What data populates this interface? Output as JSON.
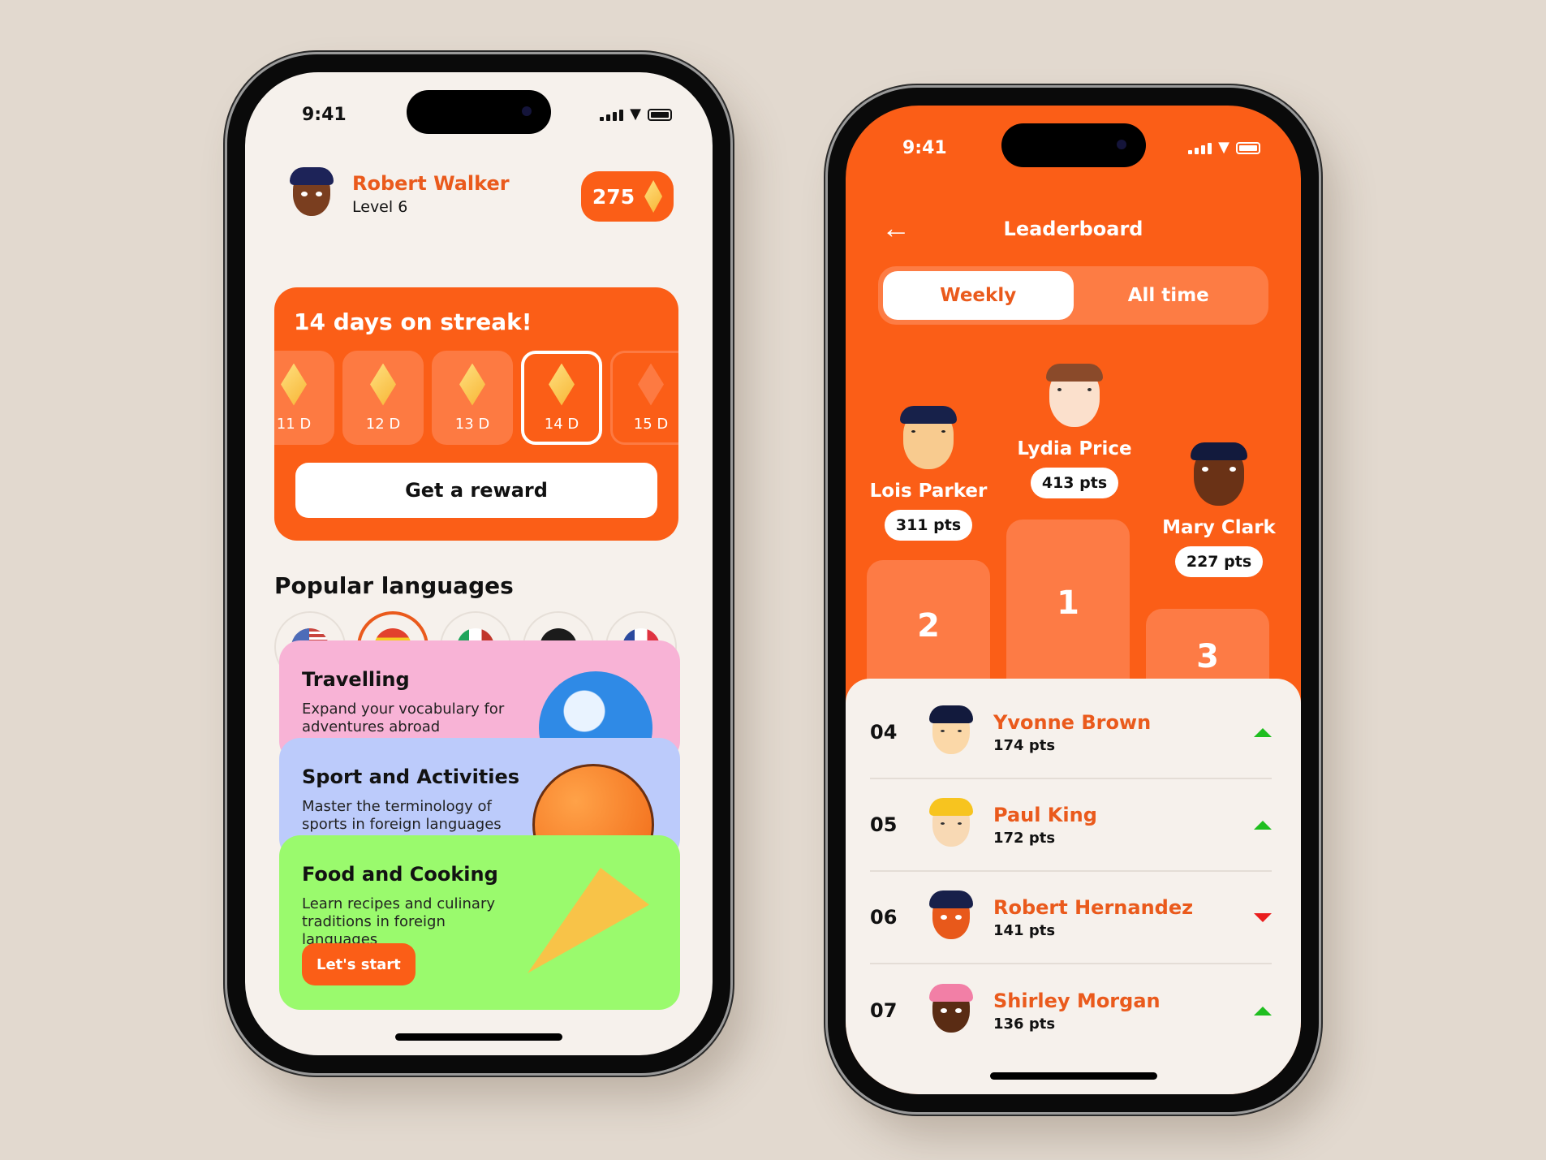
{
  "colors": {
    "accent": "#fb5e17",
    "up": "#1fbe1f",
    "down": "#ea1d1d"
  },
  "home_screen": {
    "status": {
      "time": "9:41",
      "icons": [
        "signal-icon",
        "wifi-icon",
        "battery-icon"
      ]
    },
    "user": {
      "name": "Robert Walker",
      "level": "Level 6"
    },
    "gems": {
      "count": "275",
      "icon": "gem-icon"
    },
    "streak": {
      "title": "14 days on streak!",
      "days": [
        {
          "label": "11 D",
          "state": "done"
        },
        {
          "label": "12 D",
          "state": "done"
        },
        {
          "label": "13 D",
          "state": "done"
        },
        {
          "label": "14 D",
          "state": "current"
        },
        {
          "label": "15 D",
          "state": "future"
        }
      ],
      "reward_button": "Get a reward"
    },
    "popular_languages": {
      "title": "Popular languages",
      "flags": [
        {
          "country": "United States",
          "icon": "us-flag-icon",
          "selected": false
        },
        {
          "country": "Spain",
          "icon": "spain-flag-icon",
          "selected": true
        },
        {
          "country": "Italy",
          "icon": "italy-flag-icon",
          "selected": false
        },
        {
          "country": "Germany",
          "icon": "germany-flag-icon",
          "selected": false
        },
        {
          "country": "France",
          "icon": "france-flag-icon",
          "selected": false
        }
      ]
    },
    "topics": [
      {
        "title": "Travelling",
        "desc": "Expand your vocabulary for adventures abroad",
        "illustration": "globe-icon"
      },
      {
        "title": "Sport and Activities",
        "desc": "Master the terminology of sports in foreign languages",
        "illustration": "basketball-icon"
      },
      {
        "title": "Food and Cooking",
        "desc": "Learn recipes and culinary traditions in foreign languages",
        "illustration": "pizza-icon",
        "button": "Let's start"
      }
    ]
  },
  "leaderboard_screen": {
    "status": {
      "time": "9:41"
    },
    "title": "Leaderboard",
    "back_icon": "arrow-left-icon",
    "tabs": [
      {
        "label": "Weekly",
        "active": true
      },
      {
        "label": "All time",
        "active": false
      }
    ],
    "podium": [
      {
        "place": "2",
        "name": "Lois Parker",
        "pts": "311 pts"
      },
      {
        "place": "1",
        "name": "Lydia Price",
        "pts": "413 pts"
      },
      {
        "place": "3",
        "name": "Mary Clark",
        "pts": "227 pts"
      }
    ],
    "list": [
      {
        "rank": "04",
        "name": "Yvonne Brown",
        "pts": "174 pts",
        "trend": "up"
      },
      {
        "rank": "05",
        "name": "Paul King",
        "pts": "172 pts",
        "trend": "up"
      },
      {
        "rank": "06",
        "name": "Robert Hernandez",
        "pts": "141 pts",
        "trend": "down"
      },
      {
        "rank": "07",
        "name": "Shirley Morgan",
        "pts": "136 pts",
        "trend": "up"
      }
    ]
  }
}
